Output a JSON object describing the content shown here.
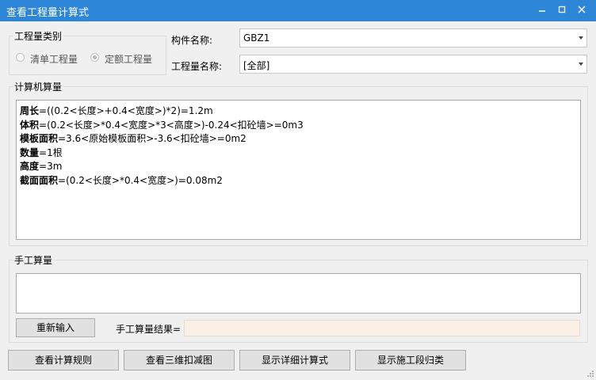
{
  "window": {
    "title": "查看工程量计算式",
    "minimize_icon": "minimize-icon",
    "maximize_icon": "maximize-icon",
    "close_icon": "close-icon"
  },
  "category": {
    "group_label": "工程量类别",
    "options": [
      {
        "label": "清单工程量",
        "selected": false
      },
      {
        "label": "定额工程量",
        "selected": true
      }
    ]
  },
  "component": {
    "label": "构件名称:",
    "value": "GBZ1"
  },
  "quantity_name": {
    "label": "工程量名称:",
    "value": "[全部]"
  },
  "computed": {
    "group_label": "计算机算量",
    "lines": [
      {
        "key": "周长",
        "expr": "=((0.2<长度>+0.4<宽度>)*2)=1.2m"
      },
      {
        "key": "体积",
        "expr": "=(0.2<长度>*0.4<宽度>*3<高度>)-0.24<扣砼墙>=0m3"
      },
      {
        "key": "模板面积",
        "expr": "=3.6<原始模板面积>-3.6<扣砼墙>=0m2"
      },
      {
        "key": "数量",
        "expr": "=1根"
      },
      {
        "key": "高度",
        "expr": "=3m"
      },
      {
        "key": "截面面积",
        "expr": "=(0.2<长度>*0.4<宽度>)=0.08m2"
      }
    ]
  },
  "manual": {
    "group_label": "手工算量",
    "reinput_label": "重新输入",
    "result_label": "手工算量结果=",
    "result_value": ""
  },
  "footer": {
    "buttons": [
      "查看计算规则",
      "查看三维扣减图",
      "显示详细计算式",
      "显示施工段归类"
    ]
  },
  "colors": {
    "titlebar": "#2e86d8",
    "result_bg": "#fbf0e6"
  }
}
